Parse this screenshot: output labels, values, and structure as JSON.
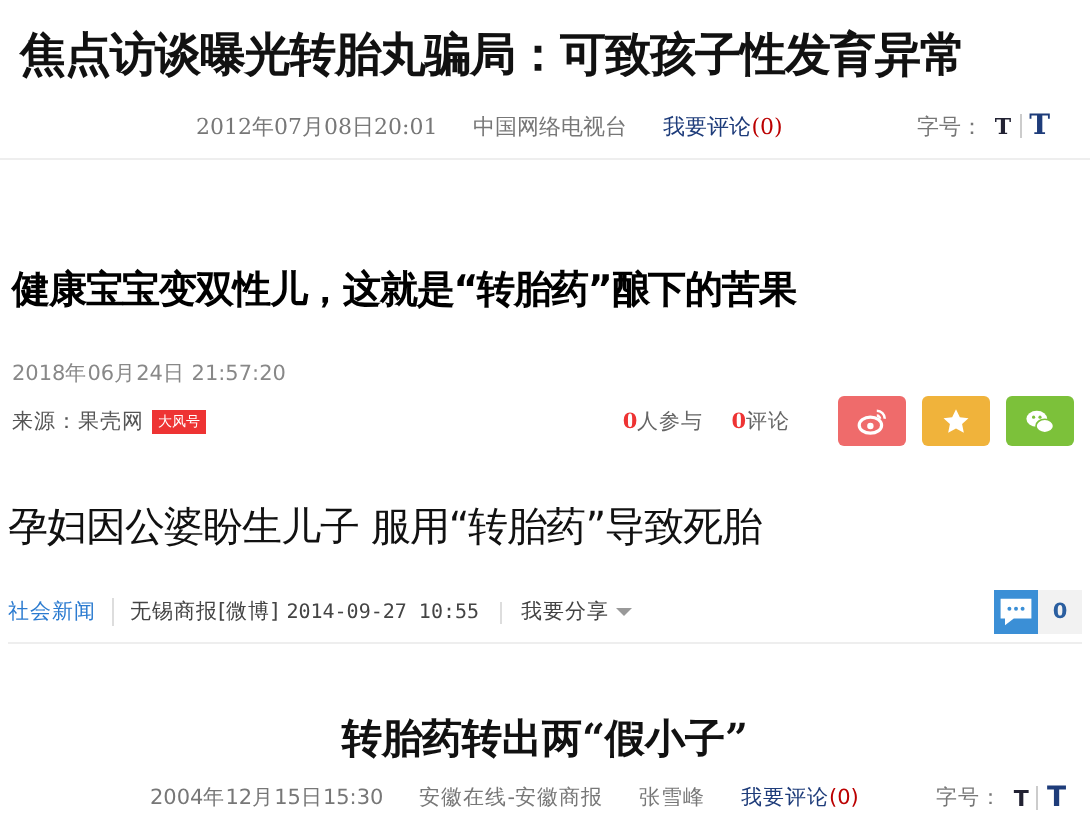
{
  "articles": [
    {
      "kind": "classic",
      "headline": "焦点访谈曝光转胎丸骗局：可致孩子性发育异常",
      "date": "2012年07月08日20:01",
      "sources": [
        "中国网络电视台"
      ],
      "comment_link": "我要评论",
      "comment_count": "(0)",
      "font_size_label": "字号：",
      "size_small": "T",
      "size_large": "T"
    },
    {
      "kind": "modern",
      "headline": "健康宝宝变双性儿，这就是“转胎药”酿下的苦果",
      "date": "2018年06月24日 21:57:20",
      "source": "来源：果壳网",
      "badge": "大风号",
      "participants_count": "0",
      "participants_label": "人参与",
      "comments_count": "0",
      "comments_label": "评论"
    },
    {
      "kind": "channel",
      "headline": "孕妇因公婆盼生儿子 服用“转胎药”导致死胎",
      "channel": "社会新闻",
      "source": "无锡商报[微博]",
      "date": "2014-09-27 10:55",
      "share": "我要分享",
      "comment_count": "0"
    },
    {
      "kind": "centered",
      "headline": "转胎药转出两“假小子”",
      "date": "2004年12月15日15:30",
      "sources": [
        "安徽在线-安徽商报",
        "张雪峰"
      ],
      "comment_link": "我要评论",
      "comment_count": "(0)",
      "font_size_label": "字号：",
      "size_small": "T",
      "size_large": "T"
    }
  ]
}
